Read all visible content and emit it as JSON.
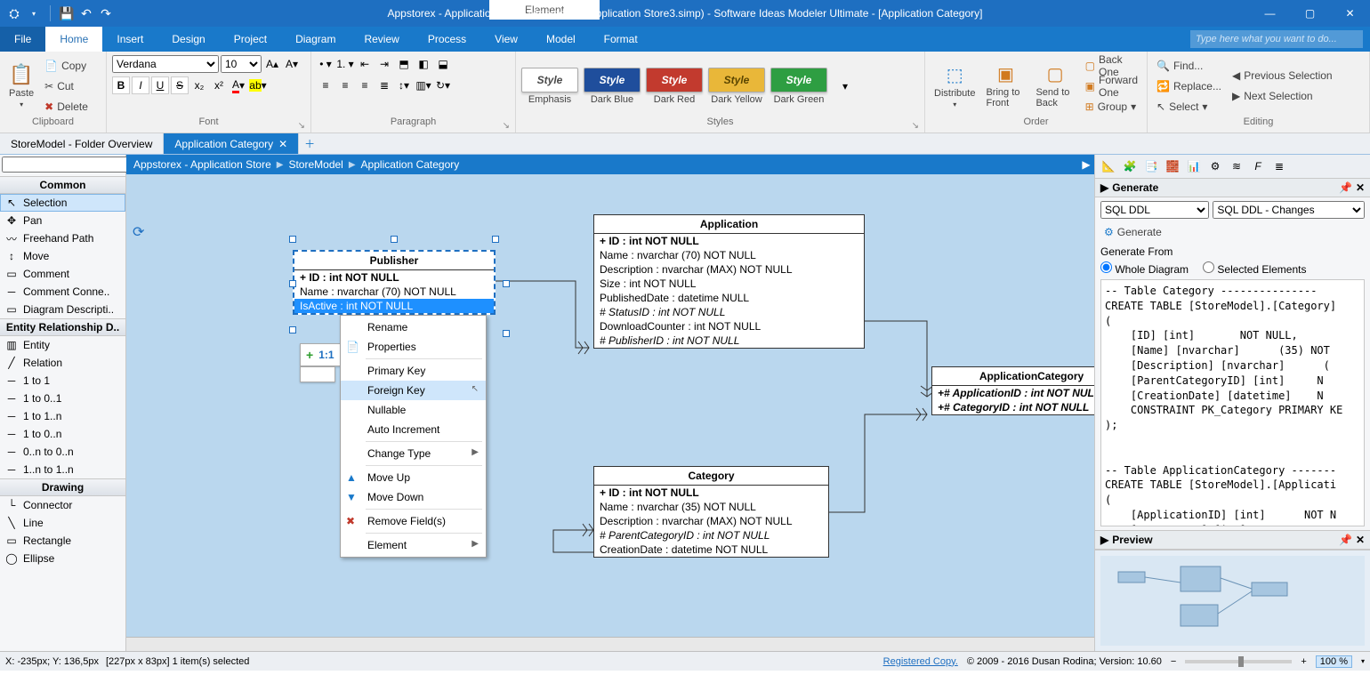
{
  "titlebar": {
    "element_tab": "Element",
    "title": "Appstorex - Application Store (Appstorex - Application Store3.simp)  - Software Ideas Modeler Ultimate - [Application Category]"
  },
  "menu": {
    "file": "File",
    "tabs": [
      "Home",
      "Insert",
      "Design",
      "Project",
      "Diagram",
      "Review",
      "Process",
      "View",
      "Model",
      "Format"
    ],
    "active_tab": "Home",
    "search_placeholder": "Type here what you want to do..."
  },
  "ribbon": {
    "clipboard": {
      "paste": "Paste",
      "copy": "Copy",
      "cut": "Cut",
      "delete": "Delete",
      "label": "Clipboard"
    },
    "font": {
      "name": "Verdana",
      "size": "10",
      "label": "Font"
    },
    "paragraph": {
      "label": "Paragraph"
    },
    "styles": {
      "label": "Styles",
      "items": [
        {
          "caption": "Emphasis",
          "bg": "#ffffff",
          "fg": "#4a4a4a"
        },
        {
          "caption": "Dark Blue",
          "bg": "#1f4e9c",
          "fg": "#ffffff"
        },
        {
          "caption": "Dark Red",
          "bg": "#c23a2e",
          "fg": "#ffffff"
        },
        {
          "caption": "Dark Yellow",
          "bg": "#e9b739",
          "fg": "#5a4500"
        },
        {
          "caption": "Dark Green",
          "bg": "#2e9e42",
          "fg": "#ffffff"
        }
      ],
      "chip_label": "Style"
    },
    "order": {
      "distribute": "Distribute",
      "bring_front": "Bring to Front",
      "send_back": "Send to Back",
      "back_one": "Back One",
      "forward_one": "Forward One",
      "group": "Group",
      "label": "Order"
    },
    "editing": {
      "find": "Find...",
      "replace": "Replace...",
      "select": "Select",
      "prev_selection": "Previous Selection",
      "next_selection": "Next Selection",
      "label": "Editing"
    }
  },
  "doc_tabs": [
    {
      "label": "StoreModel - Folder Overview",
      "active": false
    },
    {
      "label": "Application Category",
      "active": true
    }
  ],
  "breadcrumb": [
    "Appstorex - Application Store",
    "StoreModel",
    "Application Category"
  ],
  "toolbox": {
    "sections": [
      {
        "title": "Common",
        "tools": [
          {
            "label": "Selection",
            "active": true,
            "icon": "↖"
          },
          {
            "label": "Pan",
            "icon": "✥"
          },
          {
            "label": "Freehand Path",
            "icon": "〰"
          },
          {
            "label": "Move",
            "icon": "↕"
          },
          {
            "label": "Comment",
            "icon": "▭"
          },
          {
            "label": "Comment Conne..",
            "icon": "─"
          },
          {
            "label": "Diagram Descripti..",
            "icon": "▭"
          }
        ]
      },
      {
        "title": "Entity Relationship D..",
        "tools": [
          {
            "label": "Entity",
            "icon": "▥"
          },
          {
            "label": "Relation",
            "icon": "╱"
          },
          {
            "label": "1 to 1",
            "icon": "─"
          },
          {
            "label": "1 to 0..1",
            "icon": "─"
          },
          {
            "label": "1 to 1..n",
            "icon": "─"
          },
          {
            "label": "1 to 0..n",
            "icon": "─"
          },
          {
            "label": "0..n to 0..n",
            "icon": "─"
          },
          {
            "label": "1..n to 1..n",
            "icon": "─"
          }
        ]
      },
      {
        "title": "Drawing",
        "tools": [
          {
            "label": "Connector",
            "icon": "└"
          },
          {
            "label": "Line",
            "icon": "╲"
          },
          {
            "label": "Rectangle",
            "icon": "▭"
          },
          {
            "label": "Ellipse",
            "icon": "◯"
          }
        ]
      }
    ]
  },
  "entities": {
    "publisher": {
      "title": "Publisher",
      "rows": [
        "+ ID : int NOT NULL",
        "Name : nvarchar (70)  NOT NULL",
        "IsActive : int NOT NULL"
      ]
    },
    "application": {
      "title": "Application",
      "rows": [
        "+ ID : int NOT NULL",
        "Name : nvarchar (70)  NOT NULL",
        "Description : nvarchar (MAX)  NOT NULL",
        "Size : int NOT NULL",
        "PublishedDate : datetime NULL",
        "# StatusID : int NOT NULL",
        "DownloadCounter : int NOT NULL",
        "# PublisherID : int NOT NULL"
      ]
    },
    "appcat": {
      "title": "ApplicationCategory",
      "rows": [
        "+# ApplicationID : int NOT NULL",
        "+# CategoryID : int NOT NULL"
      ]
    },
    "category": {
      "title": "Category",
      "rows": [
        "+ ID : int NOT NULL",
        "Name : nvarchar (35)  NOT NULL",
        "Description : nvarchar (MAX)  NOT NULL",
        "# ParentCategoryID : int NOT NULL",
        "CreationDate : datetime NOT NULL"
      ]
    }
  },
  "quick_toolbar": {
    "badge": "1:1"
  },
  "ctxmenu": {
    "rename": "Rename",
    "properties": "Properties",
    "primary_key": "Primary Key",
    "foreign_key": "Foreign Key",
    "nullable": "Nullable",
    "auto_increment": "Auto Increment",
    "change_type": "Change Type",
    "move_up": "Move Up",
    "move_down": "Move Down",
    "remove_field": "Remove Field(s)",
    "element": "Element"
  },
  "right": {
    "generate_title": "Generate",
    "template_types": [
      "SQL DDL"
    ],
    "template_types_sel": "SQL DDL",
    "template_variants": [
      "SQL DDL - Changes"
    ],
    "template_variants_sel": "SQL DDL - Changes",
    "generate_btn": "Generate",
    "generate_from": "Generate From",
    "radio_whole": "Whole Diagram",
    "radio_selected": "Selected Elements",
    "preview_title": "Preview",
    "code": "-- Table Category ---------------\nCREATE TABLE [StoreModel].[Category]\n(\n    [ID] [int]       NOT NULL,\n    [Name] [nvarchar]      (35) NOT\n    [Description] [nvarchar]      (\n    [ParentCategoryID] [int]     N\n    [CreationDate] [datetime]    N\n    CONSTRAINT PK_Category PRIMARY KE\n);\n\n\n-- Table ApplicationCategory -------\nCREATE TABLE [StoreModel].[Applicati\n(\n    [ApplicationID] [int]      NOT N\n    [CategoryID] [int]      NOT NULL,\n    CONSTRAINT PK ApplicationCategory"
  },
  "status": {
    "coords": "X: -235px; Y: 136,5px",
    "selection": "[227px x 83px] 1 item(s) selected",
    "registered": "Registered Copy.",
    "copyright": "© 2009 - 2016 Dusan Rodina; Version: 10.60",
    "zoom": "100 %"
  }
}
